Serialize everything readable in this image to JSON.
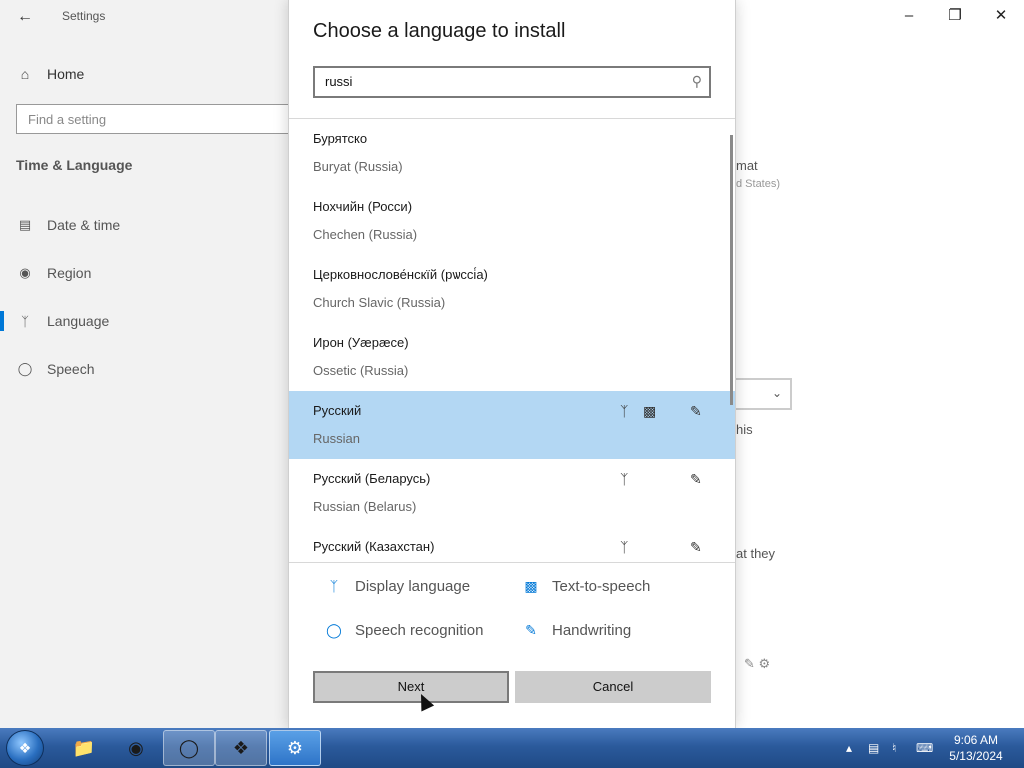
{
  "settings": {
    "title": "Settings",
    "home": "Home",
    "search_placeholder": "Find a setting",
    "section": "Time & Language",
    "nav": [
      {
        "label": "Date & time",
        "icon": "calendar-clock-icon"
      },
      {
        "label": "Region",
        "icon": "globe-icon"
      },
      {
        "label": "Language",
        "icon": "language-icon"
      },
      {
        "label": "Speech",
        "icon": "microphone-icon"
      }
    ],
    "selected_nav": "Language",
    "background_fragments": {
      "format": "mat",
      "states": "d States)",
      "this": "his",
      "that_they": "at they"
    }
  },
  "dialog": {
    "title": "Choose a language to install",
    "search_value": "russi",
    "languages": [
      {
        "native": "Бурятско",
        "english": "Buryat (Russia)",
        "display": false,
        "tts": false,
        "handwriting": false,
        "selected": false
      },
      {
        "native": "Нохчийн (Росси)",
        "english": "Chechen (Russia)",
        "display": false,
        "tts": false,
        "handwriting": false,
        "selected": false
      },
      {
        "native": "Церковнослове́нскїй (рѡссі́а)",
        "english": "Church Slavic (Russia)",
        "display": false,
        "tts": false,
        "handwriting": false,
        "selected": false
      },
      {
        "native": "Ирон (Уæрæсе)",
        "english": "Ossetic (Russia)",
        "display": false,
        "tts": false,
        "handwriting": false,
        "selected": false
      },
      {
        "native": "Русский",
        "english": "Russian",
        "display": true,
        "tts": true,
        "handwriting": true,
        "selected": true
      },
      {
        "native": "Русский (Беларусь)",
        "english": "Russian (Belarus)",
        "display": true,
        "tts": false,
        "handwriting": true,
        "selected": false
      },
      {
        "native": "Русский (Казахстан)",
        "english": "",
        "display": true,
        "tts": false,
        "handwriting": true,
        "selected": false
      }
    ],
    "legend": {
      "display_language": "Display language",
      "text_to_speech": "Text-to-speech",
      "speech_recognition": "Speech recognition",
      "handwriting": "Handwriting"
    },
    "next_label": "Next",
    "cancel_label": "Cancel"
  },
  "taskbar": {
    "time": "9:06 AM",
    "date": "5/13/2024",
    "apps": [
      "file-explorer-icon",
      "firefox-icon",
      "chrome-icon",
      "windows-app-icon",
      "settings-gear-icon"
    ]
  },
  "colors": {
    "accent": "#0078d7",
    "selected_row": "#b3d7f3",
    "button": "#cccccc"
  }
}
